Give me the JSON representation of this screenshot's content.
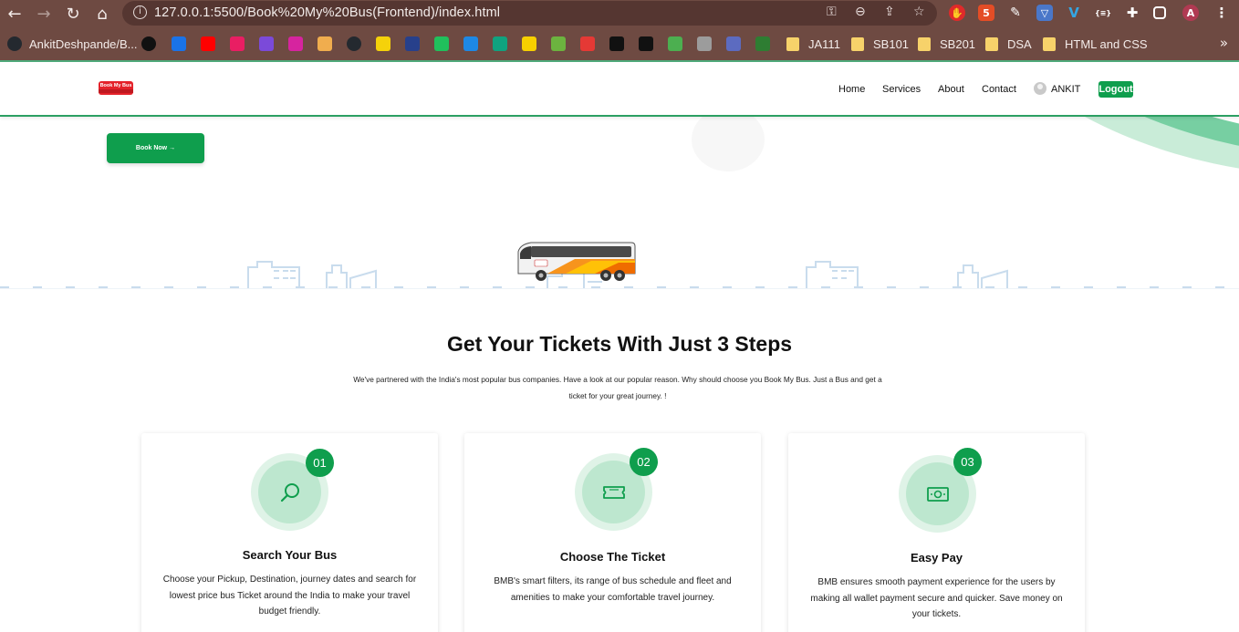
{
  "browser": {
    "url": "127.0.0.1:5500/Book%20My%20Bus(Frontend)/index.html",
    "bookmarks": [
      {
        "label": "AnkitDeshpande/B...",
        "color": "#24292f",
        "glyph": "github-icon"
      },
      {
        "label": "",
        "color": "#111111",
        "glyph": "m-icon"
      },
      {
        "label": "",
        "color": "#1a73e8",
        "glyph": "calendar-icon"
      },
      {
        "label": "",
        "color": "#ff0000",
        "glyph": "youtube-icon"
      },
      {
        "label": "",
        "color": "#e91e63",
        "glyph": "app-icon"
      },
      {
        "label": "",
        "color": "#7b4ad9",
        "glyph": "mail-icon"
      },
      {
        "label": "",
        "color": "#d6249f",
        "glyph": "instagram-icon"
      },
      {
        "label": "",
        "color": "#f0ad4e",
        "glyph": "stack-icon"
      },
      {
        "label": "",
        "color": "#24292f",
        "glyph": "github-icon"
      },
      {
        "label": "",
        "color": "#f5d20a",
        "glyph": "link-icon"
      },
      {
        "label": "",
        "color": "#27408b",
        "glyph": "globe-icon"
      },
      {
        "label": "",
        "color": "#20c05c",
        "glyph": "check-icon"
      },
      {
        "label": "",
        "color": "#1e88e5",
        "glyph": "drop-icon"
      },
      {
        "label": "",
        "color": "#10a37f",
        "glyph": "chat-icon"
      },
      {
        "label": "",
        "color": "#f7d000",
        "glyph": "miro-icon"
      },
      {
        "label": "",
        "color": "#6cb33f",
        "glyph": "leaf-icon"
      },
      {
        "label": "",
        "color": "#e53935",
        "glyph": "oracle-icon"
      },
      {
        "label": "",
        "color": "#111111",
        "glyph": "m2-icon"
      },
      {
        "label": "",
        "color": "#111111",
        "glyph": "dots-icon"
      },
      {
        "label": "",
        "color": "#4caf50",
        "glyph": "frame-icon"
      },
      {
        "label": "",
        "color": "#9c9c9c",
        "glyph": "bars-icon"
      },
      {
        "label": "",
        "color": "#5c6bc0",
        "glyph": "feather-icon"
      },
      {
        "label": "",
        "color": "#2e7d32",
        "glyph": "brain-icon"
      },
      {
        "label": "JA111",
        "color": "#f7d26a",
        "glyph": "folder-icon"
      },
      {
        "label": "SB101",
        "color": "#f7d26a",
        "glyph": "folder-icon"
      },
      {
        "label": "SB201",
        "color": "#f7d26a",
        "glyph": "folder-icon"
      },
      {
        "label": "DSA",
        "color": "#f7d26a",
        "glyph": "folder-icon"
      },
      {
        "label": "HTML and CSS",
        "color": "#f7d26a",
        "glyph": "folder-icon"
      }
    ],
    "more": "»"
  },
  "navbar": {
    "logo_top": "Book My Bus",
    "links": [
      "Home",
      "Services",
      "About",
      "Contact"
    ],
    "user": "ANKIT",
    "logout": "Logout"
  },
  "hero": {
    "book_button": "Book Now  →"
  },
  "steps": {
    "title": "Get Your Tickets With Just 3 Steps",
    "description": "We've partnered with the India's most popular bus companies. Have a look at our popular reason. Why should choose you Book My Bus. Just a Bus and get a ticket for your great journey. !",
    "cards": [
      {
        "badge": "01",
        "title": "Search Your Bus",
        "text": "Choose your Pickup, Destination, journey dates and search for lowest price bus Ticket around the India to make your travel budget friendly.",
        "icon": "search-icon"
      },
      {
        "badge": "02",
        "title": "Choose The Ticket",
        "text": "BMB's smart filters, its range of bus schedule and fleet and amenities to make your comfortable travel journey.",
        "icon": "ticket-icon"
      },
      {
        "badge": "03",
        "title": "Easy Pay",
        "text": "BMB ensures smooth payment experience for the users by making all wallet payment secure and quicker. Save money on your tickets.",
        "icon": "money-icon"
      }
    ]
  },
  "colors": {
    "brand_green": "#0f9e4d",
    "chrome_bg": "#6e4a42",
    "logo_red": "#e4222a"
  }
}
